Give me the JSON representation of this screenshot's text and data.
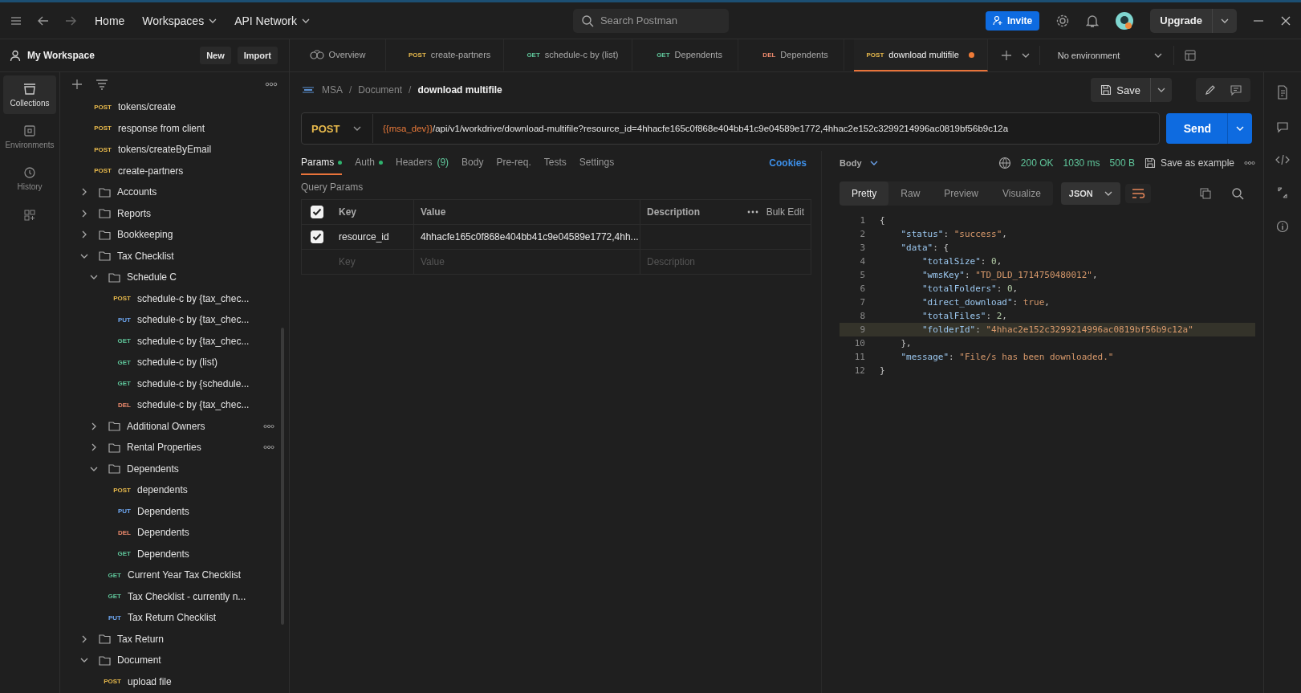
{
  "topbar": {
    "nav": [
      {
        "label": "Home",
        "dropdown": false
      },
      {
        "label": "Workspaces",
        "dropdown": true
      },
      {
        "label": "API Network",
        "dropdown": true
      }
    ],
    "search": {
      "placeholder": "Search Postman"
    },
    "invite": "Invite",
    "upgrade": "Upgrade"
  },
  "workspace": {
    "name": "My Workspace",
    "buttons": [
      "New",
      "Import"
    ]
  },
  "rail": [
    {
      "label": "Collections",
      "kind": "collections",
      "selected": true
    },
    {
      "label": "Environments",
      "kind": "environments",
      "selected": false
    },
    {
      "label": "History",
      "kind": "history",
      "selected": false
    }
  ],
  "sidebar": {
    "items": [
      {
        "kind": "request",
        "method": "POST",
        "name": "tokens/create"
      },
      {
        "kind": "request",
        "method": "POST",
        "name": "response from client"
      },
      {
        "kind": "request",
        "method": "POST",
        "name": "tokens/createByEmail"
      },
      {
        "kind": "request",
        "method": "POST",
        "name": "create-partners"
      },
      {
        "kind": "folder",
        "name": "Accounts",
        "expanded": false
      },
      {
        "kind": "folder",
        "name": "Reports",
        "expanded": false
      },
      {
        "kind": "folder",
        "name": "Bookkeeping",
        "expanded": false
      },
      {
        "kind": "folder",
        "name": "Tax Checklist",
        "expanded": true,
        "children": [
          {
            "kind": "folder",
            "name": "Schedule C",
            "expanded": true,
            "children": [
              {
                "kind": "request",
                "method": "POST",
                "name": "schedule-c by {tax_chec..."
              },
              {
                "kind": "request",
                "method": "PUT",
                "name": "schedule-c by {tax_chec..."
              },
              {
                "kind": "request",
                "method": "GET",
                "name": "schedule-c by {tax_chec..."
              },
              {
                "kind": "request",
                "method": "GET",
                "name": "schedule-c by (list)"
              },
              {
                "kind": "request",
                "method": "GET",
                "name": "schedule-c by {schedule..."
              },
              {
                "kind": "request",
                "method": "DEL",
                "name": "schedule-c by {tax_chec..."
              }
            ]
          },
          {
            "kind": "folder",
            "name": "Additional Owners",
            "expanded": false,
            "more": true
          },
          {
            "kind": "folder",
            "name": "Rental Properties",
            "expanded": false,
            "more": true
          },
          {
            "kind": "folder",
            "name": "Dependents",
            "expanded": true,
            "children": [
              {
                "kind": "request",
                "method": "POST",
                "name": "dependents"
              },
              {
                "kind": "request",
                "method": "PUT",
                "name": "Dependents"
              },
              {
                "kind": "request",
                "method": "DEL",
                "name": "Dependents"
              },
              {
                "kind": "request",
                "method": "GET",
                "name": "Dependents"
              }
            ]
          },
          {
            "kind": "request",
            "method": "GET",
            "name": "Current Year Tax Checklist"
          },
          {
            "kind": "request",
            "method": "GET",
            "name": "Tax Checklist - currently n..."
          },
          {
            "kind": "request",
            "method": "PUT",
            "name": "Tax Return Checklist"
          }
        ]
      },
      {
        "kind": "folder",
        "name": "Tax Return",
        "expanded": false
      },
      {
        "kind": "folder",
        "name": "Document",
        "expanded": true,
        "children": [
          {
            "kind": "request",
            "method": "POST",
            "name": "upload file"
          }
        ]
      }
    ]
  },
  "tabs": [
    {
      "kind": "overview",
      "name": "Overview",
      "selected": false,
      "modified": false
    },
    {
      "kind": "request",
      "method": "POST",
      "name": "create-partners",
      "selected": false,
      "modified": false
    },
    {
      "kind": "request",
      "method": "GET",
      "name": "schedule-c by (list)",
      "selected": false,
      "modified": false
    },
    {
      "kind": "request",
      "method": "GET",
      "name": "Dependents",
      "selected": false,
      "modified": false
    },
    {
      "kind": "request",
      "method": "DEL",
      "name": "Dependents",
      "selected": false,
      "modified": false
    },
    {
      "kind": "request",
      "method": "POST",
      "name": "download multifile",
      "selected": true,
      "modified": true
    }
  ],
  "environment": "No environment",
  "breadcrumb": {
    "separator": "/",
    "items": [
      "MSA",
      "Document",
      "download multifile"
    ]
  },
  "save": "Save",
  "request": {
    "method": "POST",
    "url_variable": "{{msa_dev}}",
    "url_path": "/api/v1/workdrive/download-multifile?resource_id=4hhacfe165c0f868e404bb41c9e04589e1772,4hhac2e152c3299214996ac0819bf56b9c12a",
    "send": "Send"
  },
  "request_tabs": [
    {
      "label": "Params",
      "dot": true,
      "selected": true
    },
    {
      "label": "Auth",
      "dot": true,
      "selected": false
    },
    {
      "label": "Headers",
      "count": "(9)",
      "dot": false,
      "selected": false
    },
    {
      "label": "Body",
      "dot": false,
      "selected": false
    },
    {
      "label": "Pre-req.",
      "dot": false,
      "selected": false
    },
    {
      "label": "Tests",
      "dot": false,
      "selected": false
    },
    {
      "label": "Settings",
      "dot": false,
      "selected": false
    }
  ],
  "cookies": "Cookies",
  "query_params": {
    "title": "Query Params",
    "all_checked": true,
    "columns": [
      "Key",
      "Value",
      "Description"
    ],
    "bulk_edit": "Bulk Edit",
    "rows": [
      {
        "checked": true,
        "key": "resource_id",
        "value": "4hhacfe165c0f868e404bb41c9e04589e1772,4hh..."
      }
    ],
    "placeholders": [
      "Key",
      "Value",
      "Description"
    ]
  },
  "response": {
    "section": "Body",
    "status": "200 OK",
    "time": "1030 ms",
    "size": "500 B",
    "save_example": "Save as example",
    "views": [
      {
        "label": "Pretty",
        "selected": true
      },
      {
        "label": "Raw",
        "selected": false
      },
      {
        "label": "Preview",
        "selected": false
      },
      {
        "label": "Visualize",
        "selected": false
      }
    ],
    "format": "JSON",
    "lines": [
      {
        "number": "1",
        "highlighted": false,
        "tokens": [
          {
            "kind": "punct",
            "s": "{"
          }
        ]
      },
      {
        "number": "2",
        "highlighted": false,
        "tokens": [
          {
            "kind": "key",
            "s": "    \"status\""
          },
          {
            "kind": "punct",
            "s": ": "
          },
          {
            "kind": "string",
            "s": "\"success\""
          },
          {
            "kind": "punct",
            "s": ","
          }
        ]
      },
      {
        "number": "3",
        "highlighted": false,
        "tokens": [
          {
            "kind": "key",
            "s": "    \"data\""
          },
          {
            "kind": "punct",
            "s": ": {"
          }
        ]
      },
      {
        "number": "4",
        "highlighted": false,
        "tokens": [
          {
            "kind": "key",
            "s": "        \"totalSize\""
          },
          {
            "kind": "punct",
            "s": ": "
          },
          {
            "kind": "number",
            "s": "0"
          },
          {
            "kind": "punct",
            "s": ","
          }
        ]
      },
      {
        "number": "5",
        "highlighted": false,
        "tokens": [
          {
            "kind": "key",
            "s": "        \"wmsKey\""
          },
          {
            "kind": "punct",
            "s": ": "
          },
          {
            "kind": "string",
            "s": "\"TD_DLD_1714750480012\""
          },
          {
            "kind": "punct",
            "s": ","
          }
        ]
      },
      {
        "number": "6",
        "highlighted": false,
        "tokens": [
          {
            "kind": "key",
            "s": "        \"totalFolders\""
          },
          {
            "kind": "punct",
            "s": ": "
          },
          {
            "kind": "number",
            "s": "0"
          },
          {
            "kind": "punct",
            "s": ","
          }
        ]
      },
      {
        "number": "7",
        "highlighted": false,
        "tokens": [
          {
            "kind": "key",
            "s": "        \"direct_download\""
          },
          {
            "kind": "punct",
            "s": ": "
          },
          {
            "kind": "boolean",
            "s": "true"
          },
          {
            "kind": "punct",
            "s": ","
          }
        ]
      },
      {
        "number": "8",
        "highlighted": false,
        "tokens": [
          {
            "kind": "key",
            "s": "        \"totalFiles\""
          },
          {
            "kind": "punct",
            "s": ": "
          },
          {
            "kind": "number",
            "s": "2"
          },
          {
            "kind": "punct",
            "s": ","
          }
        ]
      },
      {
        "number": "9",
        "highlighted": true,
        "tokens": [
          {
            "kind": "key",
            "s": "        \"folderId\""
          },
          {
            "kind": "punct",
            "s": ": "
          },
          {
            "kind": "string",
            "s": "\"4hhac2e152c3299214996ac0819bf56b9c12a\""
          }
        ]
      },
      {
        "number": "10",
        "highlighted": false,
        "tokens": [
          {
            "kind": "punct",
            "s": "    },"
          }
        ]
      },
      {
        "number": "11",
        "highlighted": false,
        "tokens": [
          {
            "kind": "key",
            "s": "    \"message\""
          },
          {
            "kind": "punct",
            "s": ": "
          },
          {
            "kind": "string",
            "s": "\"File/s has been downloaded.\""
          }
        ]
      },
      {
        "number": "12",
        "highlighted": false,
        "tokens": [
          {
            "kind": "punct",
            "s": "}"
          }
        ]
      }
    ]
  }
}
